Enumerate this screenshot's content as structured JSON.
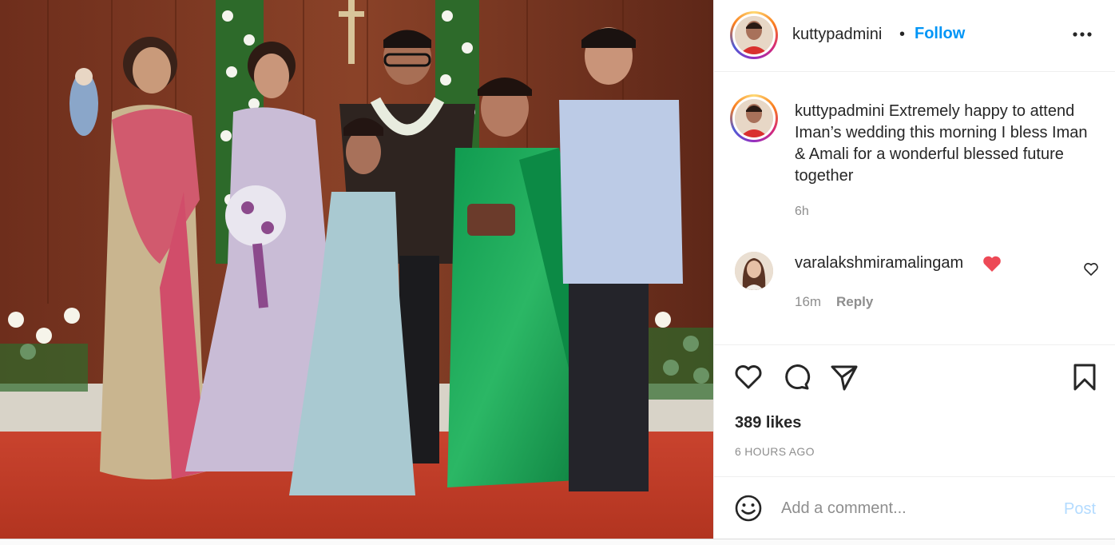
{
  "post": {
    "image_alt": "Wedding group photo",
    "colors": {
      "follow": "#0095f6",
      "post_disabled": "#b3dbff",
      "heart_red": "#ed4956",
      "muted": "#8e8e8e"
    }
  },
  "header": {
    "username": "kuttypadmini",
    "separator": "•",
    "follow_label": "Follow",
    "more_icon": "more-options-icon"
  },
  "caption": {
    "username": "kuttypadmini",
    "text": "Extremely happy to attend Iman’s wedding this morning I bless Iman & Amali for a wonderful blessed future together",
    "time": "6h"
  },
  "comments": [
    {
      "username": "varalakshmiramalingam",
      "emoji_icon": "red-heart-emoji",
      "time": "16m",
      "reply_label": "Reply"
    }
  ],
  "actions": {
    "icons": [
      "heart-icon",
      "comment-icon",
      "share-icon",
      "bookmark-icon"
    ],
    "likes": "389 likes",
    "timestamp": "6 HOURS AGO"
  },
  "add_comment": {
    "placeholder": "Add a comment...",
    "post_label": "Post",
    "emoji_icon": "emoji-icon"
  }
}
